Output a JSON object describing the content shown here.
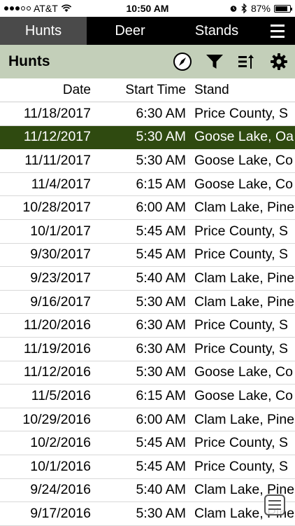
{
  "status_bar": {
    "carrier": "AT&T",
    "time": "10:50 AM",
    "battery_percent": "87%",
    "battery_level": 0.87,
    "signal_bars_filled": 3,
    "signal_bars_total": 5
  },
  "top_tabs": [
    {
      "label": "Hunts",
      "active": true
    },
    {
      "label": "Deer",
      "active": false
    },
    {
      "label": "Stands",
      "active": false
    }
  ],
  "toolbar": {
    "title": "Hunts",
    "icons": [
      "compass-icon",
      "filter-icon",
      "sort-icon",
      "gear-icon"
    ]
  },
  "table": {
    "headers": {
      "date": "Date",
      "start_time": "Start Time",
      "stand": "Stand"
    },
    "selected_index": 1,
    "rows": [
      {
        "date": "11/18/2017",
        "time": "6:30 AM",
        "stand": "Price County, S"
      },
      {
        "date": "11/12/2017",
        "time": "5:30 AM",
        "stand": "Goose Lake, Oa"
      },
      {
        "date": "11/11/2017",
        "time": "5:30 AM",
        "stand": "Goose Lake, Co"
      },
      {
        "date": "11/4/2017",
        "time": "6:15 AM",
        "stand": "Goose Lake, Co"
      },
      {
        "date": "10/28/2017",
        "time": "6:00 AM",
        "stand": "Clam Lake, Pine"
      },
      {
        "date": "10/1/2017",
        "time": "5:45 AM",
        "stand": "Price County, S"
      },
      {
        "date": "9/30/2017",
        "time": "5:45 AM",
        "stand": "Price County, S"
      },
      {
        "date": "9/23/2017",
        "time": "5:40 AM",
        "stand": "Clam Lake, Pine"
      },
      {
        "date": "9/16/2017",
        "time": "5:30 AM",
        "stand": "Clam Lake, Pine"
      },
      {
        "date": "11/20/2016",
        "time": "6:30 AM",
        "stand": "Price County, S"
      },
      {
        "date": "11/19/2016",
        "time": "6:30 AM",
        "stand": "Price County, S"
      },
      {
        "date": "11/12/2016",
        "time": "5:30 AM",
        "stand": "Goose Lake, Co"
      },
      {
        "date": "11/5/2016",
        "time": "6:15 AM",
        "stand": "Goose Lake, Co"
      },
      {
        "date": "10/29/2016",
        "time": "6:00 AM",
        "stand": "Clam Lake, Pine"
      },
      {
        "date": "10/2/2016",
        "time": "5:45 AM",
        "stand": "Price County, S"
      },
      {
        "date": "10/1/2016",
        "time": "5:45 AM",
        "stand": "Price County, S"
      },
      {
        "date": "9/24/2016",
        "time": "5:40 AM",
        "stand": "Clam Lake, Pine"
      },
      {
        "date": "9/17/2016",
        "time": "5:30 AM",
        "stand": "Clam Lake, Pine"
      }
    ]
  },
  "colors": {
    "toolbar_bg": "#c3cfb9",
    "selected_row_bg": "#2f4a10",
    "tab_bar_bg": "#000000",
    "active_tab_bg": "#4a4a4a"
  }
}
